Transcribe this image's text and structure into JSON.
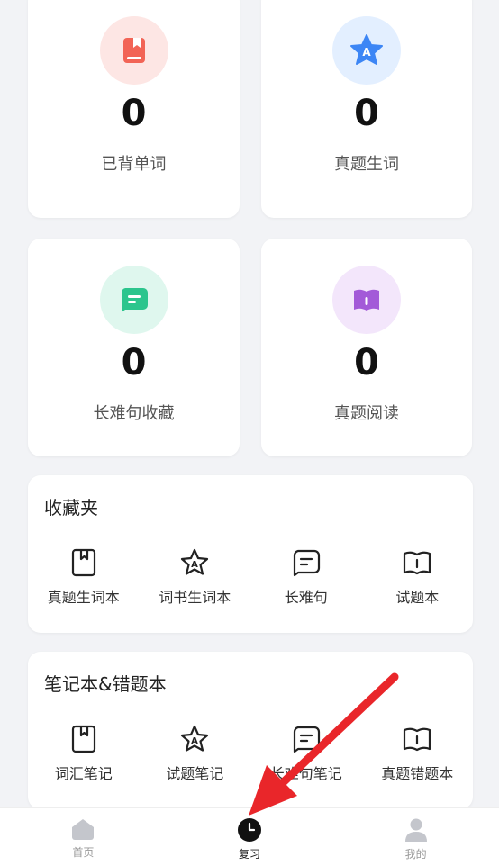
{
  "stats": [
    {
      "value": "0",
      "label": "已背单词",
      "icon": "book-icon",
      "bg": "#fde6e4",
      "color": "#f26456"
    },
    {
      "value": "0",
      "label": "真题生词",
      "icon": "star-a-icon",
      "bg": "#e3efff",
      "color": "#3d86f5"
    },
    {
      "value": "0",
      "label": "长难句收藏",
      "icon": "chat-icon",
      "bg": "#dff7ee",
      "color": "#2cc58d"
    },
    {
      "value": "0",
      "label": "真题阅读",
      "icon": "open-book-icon",
      "bg": "#f3e6fb",
      "color": "#a35ad8"
    }
  ],
  "favorites": {
    "title": "收藏夹",
    "items": [
      {
        "label": "真题生词本",
        "icon": "bookmark-book-icon"
      },
      {
        "label": "词书生词本",
        "icon": "star-a-icon"
      },
      {
        "label": "长难句",
        "icon": "chat-icon"
      },
      {
        "label": "试题本",
        "icon": "open-book-icon"
      }
    ]
  },
  "notes": {
    "title": "笔记本&错题本",
    "items": [
      {
        "label": "词汇笔记",
        "icon": "bookmark-book-icon"
      },
      {
        "label": "试题笔记",
        "icon": "star-a-icon"
      },
      {
        "label": "长难句笔记",
        "icon": "chat-icon"
      },
      {
        "label": "真题错题本",
        "icon": "open-book-icon"
      }
    ]
  },
  "tabs": [
    {
      "label": "首页",
      "icon": "home-icon"
    },
    {
      "label": "复习",
      "icon": "clock-icon",
      "active": true
    },
    {
      "label": "我的",
      "icon": "person-icon"
    }
  ],
  "accent": "#e9262a"
}
